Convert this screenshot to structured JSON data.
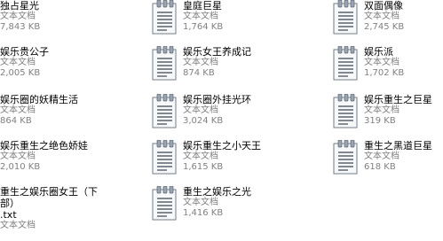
{
  "colors": {
    "name": "#000000",
    "meta": "#808080",
    "background": "#ffffff"
  },
  "icon": "notepad-text-file-icon",
  "files": [
    {
      "name": "独占星光",
      "type": "文本文档",
      "size": "7,843 KB",
      "partial_icon": true
    },
    {
      "name": "皇庭巨星",
      "type": "文本文档",
      "size": "1,764 KB"
    },
    {
      "name": "双面偶像",
      "type": "文本文档",
      "size": "2,745 KB"
    },
    {
      "name": "娱乐贵公子",
      "type": "文本文档",
      "size": "2,005 KB",
      "partial_icon": true
    },
    {
      "name": "娱乐女王养成记",
      "type": "文本文档",
      "size": "874 KB"
    },
    {
      "name": "娱乐派",
      "type": "文本文档",
      "size": "1,702 KB"
    },
    {
      "name": "娱乐圈的妖精生活",
      "type": "文本文档",
      "size": "864 KB",
      "partial_icon": true
    },
    {
      "name": "娱乐圈外挂光环",
      "type": "文本文档",
      "size": "3,024 KB"
    },
    {
      "name": "娱乐重生之巨星",
      "type": "文本文档",
      "size": "319 KB"
    },
    {
      "name": "娱乐重生之绝色娇娃",
      "type": "文本文档",
      "size": "2,010 KB",
      "partial_icon": true
    },
    {
      "name": "娱乐重生之小天王",
      "type": "文本文档",
      "size": "1,615 KB"
    },
    {
      "name": "重生之黑道巨星",
      "type": "文本文档",
      "size": "618 KB"
    },
    {
      "name": "重生之娱乐圈女王（下部）\n.txt",
      "type": "文本文档",
      "size": "",
      "partial_icon": true
    },
    {
      "name": "重生之娱乐之光",
      "type": "文本文档",
      "size": "1,416 KB"
    }
  ]
}
